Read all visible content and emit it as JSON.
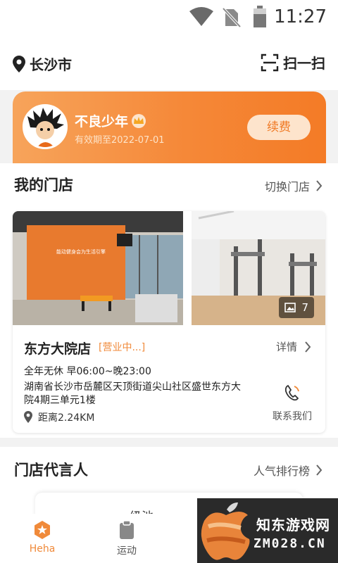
{
  "status_bar": {
    "time": "11:27"
  },
  "header": {
    "city": "长沙市",
    "scan_label": "扫一扫"
  },
  "member": {
    "name": "不良少年",
    "expire_text": "有效期至2022-07-01",
    "renew_label": "续费"
  },
  "my_store": {
    "title": "我的门店",
    "switch_label": "切换门店",
    "photo_count": "7",
    "name": "东方大院店",
    "status": "[营业中...]",
    "detail_label": "详情",
    "hours": "全年无休 早06:00~晚23:00",
    "address": "湖南省长沙市岳麓区天顶街道尖山社区盛世东方大院4期三单元1楼",
    "distance": "距离2.24KM",
    "contact_label": "联系我们"
  },
  "representatives": {
    "title": "门店代言人",
    "ranking_label": "人气排行榜",
    "partial_text": "级池"
  },
  "tab_bar": {
    "tabs": [
      {
        "label": "Heha"
      },
      {
        "label": "运动"
      }
    ]
  },
  "watermark": {
    "line1": "知东游戏网",
    "line2": "ZM028.CN"
  },
  "colors": {
    "accent": "#f08a3a",
    "card_gradient_start": "#f7a45b",
    "card_gradient_end": "#f47b26"
  }
}
